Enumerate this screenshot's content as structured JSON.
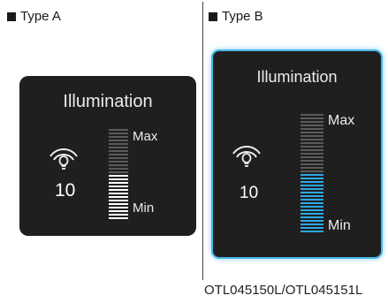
{
  "type_a": {
    "label": "Type A"
  },
  "type_b": {
    "label": "Type B"
  },
  "display": {
    "title": "Illumination",
    "level": "10",
    "max_label": "Max",
    "min_label": "Min",
    "brightness_fraction": 0.5,
    "icon": "dashboard-illumination-icon"
  },
  "colors": {
    "panel": "#1f1f1f",
    "bar_off": "#5a5a5a",
    "bar_on_a": "#ffffff",
    "bar_on_b": "#2aa8e8",
    "highlight_border": "#49b6e6"
  },
  "credit": "OTL045150L/OTL045151L"
}
